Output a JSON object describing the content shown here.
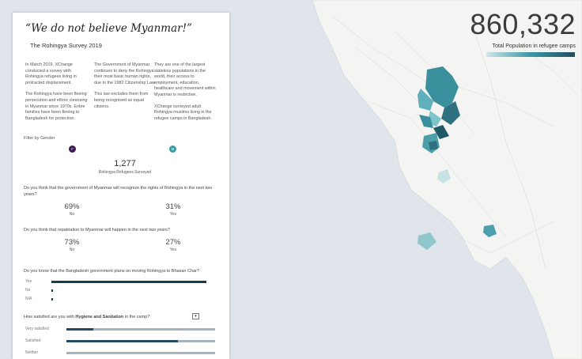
{
  "header": {
    "total_value": "860,332",
    "total_label": "Total Population in refugee camps"
  },
  "panel": {
    "title": "“We do not believe Myanmar!”",
    "subtitle": "The Rohingya Survey 2019",
    "intro_col1": [
      "In March 2019, XChange conducted a survey with Rohingya refugees living in protracted displacement.",
      "The Rohingya have been fleeing persecution and ethnic cleansing in Myanmar since 1970s. Entire families have been fleeing to Bangladesh for protection."
    ],
    "intro_col2": [
      "The Government of Myanmar continues to deny the Rohingya their most basic human rights, due to the 1982 Citizenship Law.",
      "This law excludes them from being recognised as equal citizens."
    ],
    "intro_col3": [
      "They are one of the largest stateless populations in the world, their access to employment, education, healthcare and movement within Myanmar is restrictive.",
      "XChange surveyed adult Rohingya muslims living in the refugee camps in Bangladesh."
    ],
    "filter_label": "Filter by Gender",
    "filter_female": "F",
    "filter_male": "M",
    "surveyed_count": "1,277",
    "surveyed_label": "Rohingya Refugees Surveyed",
    "q1": {
      "text": "Do you think that the government of Myanmar will recognize the rights of Rohingya in the next two years?",
      "no_pct": "69%",
      "no_label": "No",
      "yes_pct": "31%",
      "yes_label": "Yes"
    },
    "q2": {
      "text": "Do you think that repatriation to Myanmar will happen in the next two years?",
      "no_pct": "73%",
      "no_label": "No",
      "yes_pct": "27%",
      "yes_label": "Yes"
    },
    "q3": {
      "text": "Do you know that the Bangladesh government plans on moving Rohingya to Bhasan Char?",
      "bars": [
        {
          "label": "Yes",
          "value": 0.96
        },
        {
          "label": "No",
          "value": 0.01
        },
        {
          "label": "N/A",
          "value": 0.005
        }
      ]
    },
    "q4": {
      "text_prefix": "How satisfied are you with ",
      "text_bold": "Hygiene and Sanitation",
      "text_suffix": " in the camp?",
      "dropdown_icon": "▾",
      "bars": [
        {
          "label": "Very satisfied",
          "value": 0.18
        },
        {
          "label": "Satisfied",
          "value": 0.75
        },
        {
          "label": "Neither",
          "value": 0.0
        }
      ]
    }
  },
  "colors": {
    "female": "#3d1a54",
    "male": "#3a9aa2",
    "map_land": "#f3f3f2",
    "map_water": "#dde4ea",
    "choropleth_dark": "#2f7a8a",
    "choropleth_mid": "#4ea3b0",
    "choropleth_light": "#a9d2d8"
  }
}
